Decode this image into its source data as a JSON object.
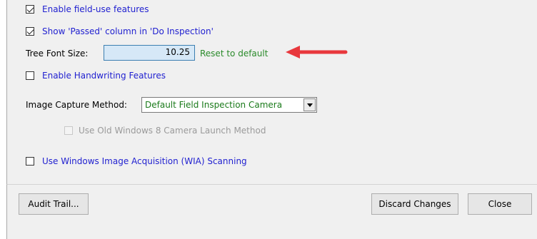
{
  "options": {
    "field_use": {
      "label": "Enable field-use features",
      "checked": true
    },
    "show_passed": {
      "label": "Show 'Passed' column in 'Do Inspection'",
      "checked": true
    },
    "tree_font_size": {
      "label": "Tree Font Size:",
      "value": "10.25",
      "reset_link": "Reset to default"
    },
    "handwriting": {
      "label": "Enable Handwriting Features",
      "checked": false
    },
    "image_capture": {
      "label": "Image Capture Method:",
      "selected": "Default Field Inspection Camera"
    },
    "old_camera": {
      "label": "Use Old Windows 8 Camera Launch Method",
      "checked": false,
      "disabled": true
    },
    "wia": {
      "label": "Use Windows Image Acquisition (WIA) Scanning",
      "checked": false
    }
  },
  "footer": {
    "audit_trail": "Audit Trail...",
    "discard_changes": "Discard Changes",
    "close": "Close"
  },
  "colors": {
    "annotation_arrow": "#e8383d",
    "link_green": "#2a8a2a",
    "label_blue": "#1f1fd0"
  }
}
